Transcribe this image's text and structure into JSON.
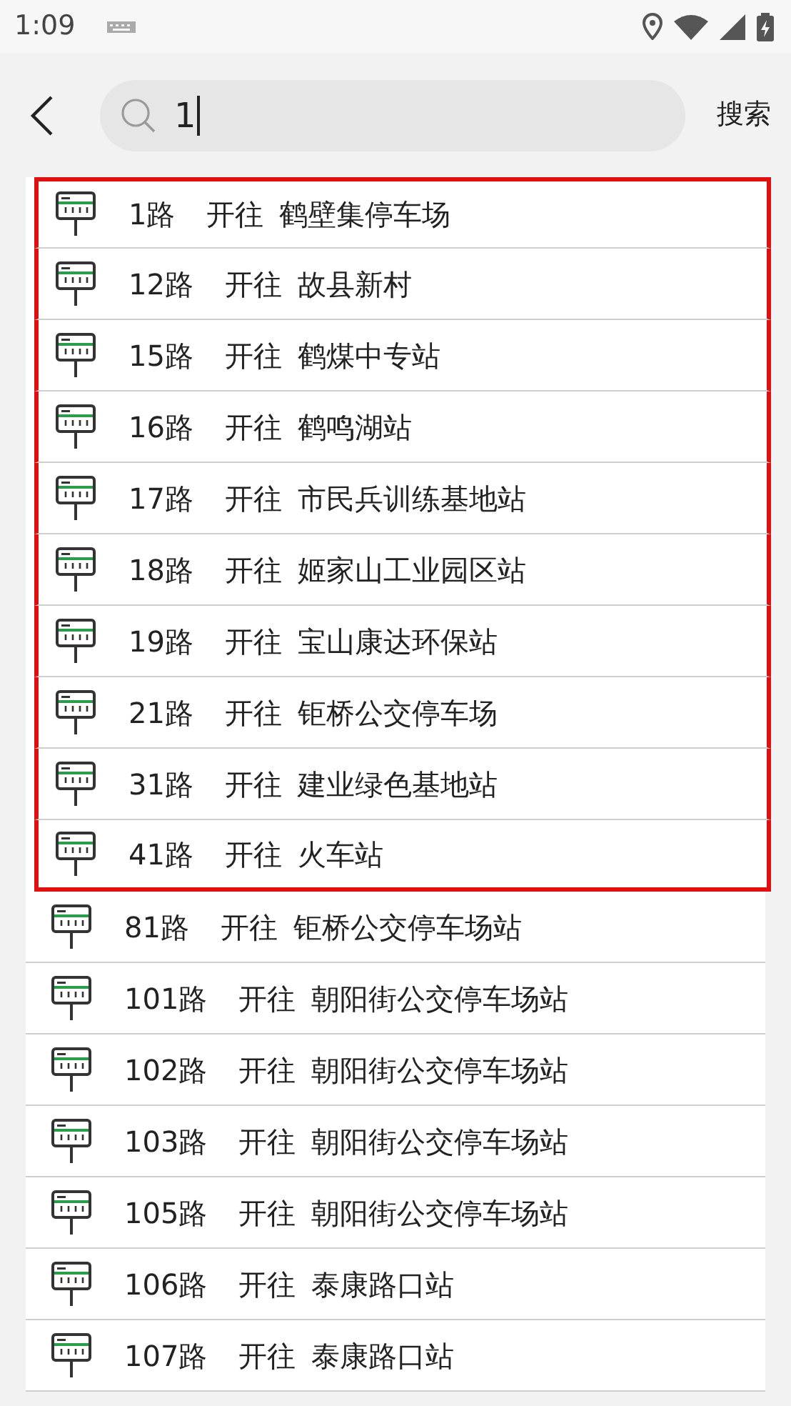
{
  "status_bar": {
    "time": "1:09"
  },
  "search": {
    "value": "1",
    "button": "搜索"
  },
  "results": [
    {
      "route": "1路",
      "direction": "开往",
      "destination": "鹤壁集停车场",
      "highlighted": true
    },
    {
      "route": "12路",
      "direction": "开往",
      "destination": "故县新村",
      "highlighted": true
    },
    {
      "route": "15路",
      "direction": "开往",
      "destination": "鹤煤中专站",
      "highlighted": true
    },
    {
      "route": "16路",
      "direction": "开往",
      "destination": "鹤鸣湖站",
      "highlighted": true
    },
    {
      "route": "17路",
      "direction": "开往",
      "destination": "市民兵训练基地站",
      "highlighted": true
    },
    {
      "route": "18路",
      "direction": "开往",
      "destination": "姬家山工业园区站",
      "highlighted": true
    },
    {
      "route": "19路",
      "direction": "开往",
      "destination": "宝山康达环保站",
      "highlighted": true
    },
    {
      "route": "21路",
      "direction": "开往",
      "destination": "钜桥公交停车场",
      "highlighted": true
    },
    {
      "route": "31路",
      "direction": "开往",
      "destination": "建业绿色基地站",
      "highlighted": true
    },
    {
      "route": "41路",
      "direction": "开往",
      "destination": "火车站",
      "highlighted": true
    },
    {
      "route": "81路",
      "direction": "开往",
      "destination": "钜桥公交停车场站",
      "highlighted": false
    },
    {
      "route": "101路",
      "direction": "开往",
      "destination": "朝阳街公交停车场站",
      "highlighted": false
    },
    {
      "route": "102路",
      "direction": "开往",
      "destination": "朝阳街公交停车场站",
      "highlighted": false
    },
    {
      "route": "103路",
      "direction": "开往",
      "destination": "朝阳街公交停车场站",
      "highlighted": false
    },
    {
      "route": "105路",
      "direction": "开往",
      "destination": "朝阳街公交停车场站",
      "highlighted": false
    },
    {
      "route": "106路",
      "direction": "开往",
      "destination": "泰康路口站",
      "highlighted": false
    },
    {
      "route": "107路",
      "direction": "开往",
      "destination": "泰康路口站",
      "highlighted": false
    }
  ]
}
